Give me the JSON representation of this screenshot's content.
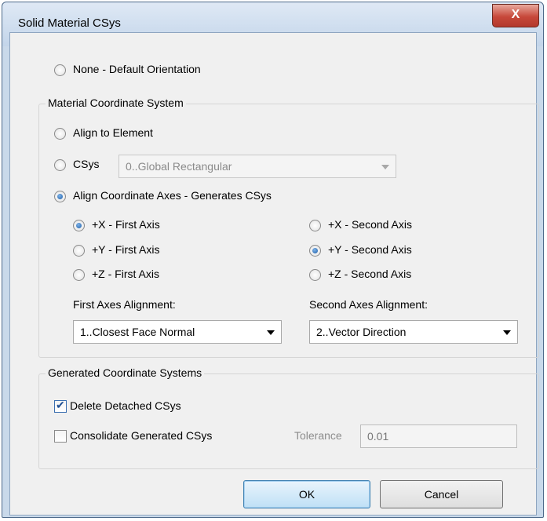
{
  "window": {
    "title": "Solid Material CSys",
    "close_glyph": "X"
  },
  "orientation": {
    "none_label": "None - Default Orientation",
    "none_selected": false
  },
  "material_cs": {
    "group_title": "Material Coordinate System",
    "align_element_label": "Align to Element",
    "csys_label": "CSys",
    "csys_value": "0..Global Rectangular",
    "align_axes_label": "Align Coordinate Axes - Generates CSys",
    "selected_mode": "align_axes",
    "first_axis": {
      "options": [
        "+X - First Axis",
        "+Y - First Axis",
        "+Z - First Axis"
      ],
      "selected": "+X - First Axis"
    },
    "second_axis": {
      "options": [
        "+X - Second Axis",
        "+Y - Second Axis",
        "+Z - Second Axis"
      ],
      "selected": "+Y - Second Axis"
    },
    "first_alignment_label": "First Axes Alignment:",
    "first_alignment_value": "1..Closest Face Normal",
    "second_alignment_label": "Second Axes Alignment:",
    "second_alignment_value": "2..Vector Direction"
  },
  "generated_cs": {
    "group_title": "Generated Coordinate Systems",
    "delete_label": "Delete Detached CSys",
    "delete_checked": true,
    "consolidate_label": "Consolidate Generated CSys",
    "consolidate_checked": false,
    "tolerance_label": "Tolerance",
    "tolerance_value": "0.01"
  },
  "buttons": {
    "ok": "OK",
    "cancel": "Cancel"
  },
  "colors": {
    "accent": "#1d5ea8",
    "close_button": "#c7483a",
    "window_frame": "#c9d9ea"
  }
}
